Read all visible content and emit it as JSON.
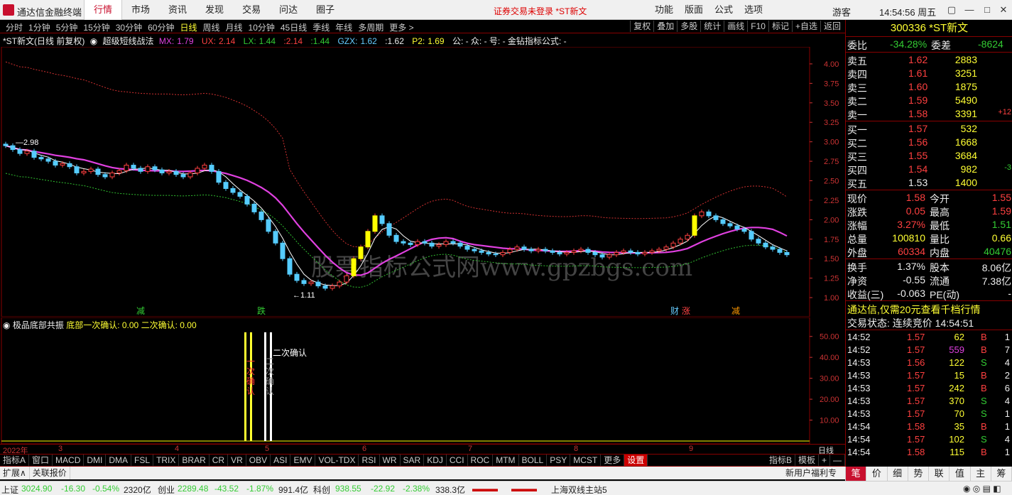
{
  "titlebar": {
    "app_name": "通达信金融终端",
    "menu": [
      "行情",
      "市场",
      "资讯",
      "发现",
      "交易",
      "问达",
      "圈子"
    ],
    "active_menu": 0,
    "notice": "证券交易未登录  *ST新文",
    "right_menu": [
      "功能",
      "版面",
      "公式",
      "选项"
    ],
    "user": "游客",
    "clock": "14:54:56 周五"
  },
  "periodbar": {
    "items": [
      "分时",
      "1分钟",
      "5分钟",
      "15分钟",
      "30分钟",
      "60分钟",
      "日线",
      "周线",
      "月线",
      "10分钟",
      "45日线",
      "季线",
      "年线",
      "多周期",
      "更多 >"
    ],
    "active": 6,
    "tools": [
      "复权",
      "叠加",
      "多股",
      "统计",
      "画线",
      "F10",
      "标记",
      "+自选",
      "返回"
    ]
  },
  "chartinfo": {
    "name": "*ST新文(日线 前复权)",
    "indicator": "超级短线战法",
    "mx_label": "MX:",
    "mx": "1.79",
    "ux_label": "UX:",
    "ux": "2.14",
    "lx_label": "LX:",
    "lx": "1.44",
    "v1": "2.14",
    "v2": "1.44",
    "gzx_label": "GZX:",
    "gzx": "1.62",
    "v3": "1.62",
    "p2_label": "P2:",
    "p2": "1.69",
    "tail": "公: -  众: -  号: -  金钻指标公式: -"
  },
  "chart_data": [
    {
      "type": "candlestick",
      "ylim": [
        0.8,
        4.2
      ],
      "y_ticks": [
        "4.00",
        "3.75",
        "3.50",
        "3.25",
        "3.00",
        "2.75",
        "2.50",
        "2.25",
        "2.00",
        "1.75",
        "1.50",
        "1.25",
        "1.00"
      ],
      "annotations": [
        "2.98",
        "1.11"
      ],
      "markers": [
        "减",
        "跌",
        "财",
        "涨",
        "减"
      ],
      "close": [
        2.95,
        2.9,
        2.85,
        2.88,
        2.8,
        2.78,
        2.75,
        2.7,
        2.72,
        2.68,
        2.6,
        2.62,
        2.65,
        2.58,
        2.55,
        2.6,
        2.63,
        2.7,
        2.66,
        2.62,
        2.68,
        2.64,
        2.6,
        2.62,
        2.58,
        2.55,
        2.6,
        2.66,
        2.7,
        2.62,
        2.48,
        2.4,
        2.35,
        2.3,
        2.2,
        2.1,
        2.0,
        1.85,
        1.7,
        1.5,
        1.3,
        1.22,
        1.18,
        1.2,
        1.15,
        1.12,
        1.15,
        1.2,
        1.28,
        1.5,
        1.65,
        1.85,
        2.05,
        1.95,
        1.8,
        1.72,
        1.7,
        1.68,
        1.72,
        1.7,
        1.66,
        1.68,
        1.72,
        1.7,
        1.66,
        1.62,
        1.6,
        1.58,
        1.56,
        1.55,
        1.58,
        1.62,
        1.65,
        1.62,
        1.6,
        1.62,
        1.6,
        1.58,
        1.56,
        1.58,
        1.6,
        1.62,
        1.58,
        1.55,
        1.52,
        1.55,
        1.58,
        1.6,
        1.58,
        1.56,
        1.58,
        1.6,
        1.62,
        1.65,
        1.7,
        1.75,
        1.8,
        2.05,
        2.1,
        2.05,
        2.0,
        1.95,
        1.92,
        1.88,
        1.85,
        1.75,
        1.7,
        1.65,
        1.62,
        1.58,
        1.55
      ],
      "series": [
        {
          "name": "MX",
          "color": "#e040e0"
        },
        {
          "name": "UX",
          "color": "#d03030"
        },
        {
          "name": "LX",
          "color": "#30c030"
        },
        {
          "name": "GZX",
          "color": "#ffffff"
        }
      ]
    },
    {
      "type": "bar",
      "ylim": [
        0,
        55
      ],
      "y_ticks": [
        "50.00",
        "40.00",
        "30.00",
        "20.00",
        "10.00"
      ],
      "bars": [
        {
          "label": "一次确认",
          "value": 52,
          "color": "#ffff30"
        },
        {
          "label": "二次确认",
          "value": 52,
          "color": "#ffffff"
        }
      ]
    }
  ],
  "subinfo": {
    "name": "极品底部共振",
    "label1": "底部一次确认:",
    "val1": "0.00",
    "label2": "二次确认:",
    "val2": "0.00",
    "annot": "二次确认"
  },
  "datebar": [
    "2022年",
    "3",
    "4",
    "5",
    "6",
    "7",
    "8",
    "9"
  ],
  "datebar_right": "日线",
  "indbar": [
    "指标A",
    "窗口",
    "MACD",
    "DMI",
    "DMA",
    "FSL",
    "TRIX",
    "BRAR",
    "CR",
    "VR",
    "OBV",
    "ASI",
    "EMV",
    "VOL-TDX",
    "RSI",
    "WR",
    "SAR",
    "KDJ",
    "CCI",
    "ROC",
    "MTM",
    "BOLL",
    "PSY",
    "MCST",
    "更多",
    "设置"
  ],
  "indbar_active": 25,
  "indbar_right": [
    "指标B",
    "模板",
    "+",
    "—"
  ],
  "expandbar": [
    "扩展∧",
    "关联报价"
  ],
  "expand_right": "新用户福利专享",
  "statusbar": {
    "sh_name": "上证",
    "sh": "3024.90",
    "sh_chg": "-16.30",
    "sh_pct": "-0.54%",
    "sh_amt": "2320亿",
    "cy_name": "创业",
    "cy": "2289.48",
    "cy_chg": "-43.52",
    "cy_pct": "-1.87%",
    "cy_amt": "991.4亿",
    "kc_name": "科创",
    "kc": "938.55",
    "kc_chg": "-22.92",
    "kc_pct": "-2.38%",
    "kc_amt": "338.3亿",
    "server": "上海双线主站5"
  },
  "rpanel": {
    "code": "300336",
    "name": "*ST新文",
    "wb_label": "委比",
    "wb": "-34.28%",
    "wc_label": "委差",
    "wc": "-8624",
    "asks": [
      {
        "label": "卖五",
        "price": "1.62",
        "vol": "2883",
        "chg": ""
      },
      {
        "label": "卖四",
        "price": "1.61",
        "vol": "3251",
        "chg": ""
      },
      {
        "label": "卖三",
        "price": "1.60",
        "vol": "1875",
        "chg": ""
      },
      {
        "label": "卖二",
        "price": "1.59",
        "vol": "5490",
        "chg": ""
      },
      {
        "label": "卖一",
        "price": "1.58",
        "vol": "3391",
        "chg": "+12"
      }
    ],
    "bids": [
      {
        "label": "买一",
        "price": "1.57",
        "vol": "532",
        "chg": ""
      },
      {
        "label": "买二",
        "price": "1.56",
        "vol": "1668",
        "chg": ""
      },
      {
        "label": "买三",
        "price": "1.55",
        "vol": "3684",
        "chg": ""
      },
      {
        "label": "买四",
        "price": "1.54",
        "vol": "982",
        "chg": "-3"
      },
      {
        "label": "买五",
        "price": "1.53",
        "vol": "1400",
        "chg": ""
      }
    ],
    "quote": [
      {
        "l1": "现价",
        "v1": "1.58",
        "c1": "red",
        "l2": "今开",
        "v2": "1.55",
        "c2": "red"
      },
      {
        "l1": "涨跌",
        "v1": "0.05",
        "c1": "red",
        "l2": "最高",
        "v2": "1.59",
        "c2": "red"
      },
      {
        "l1": "涨幅",
        "v1": "3.27%",
        "c1": "red",
        "l2": "最低",
        "v2": "1.51",
        "c2": "green"
      },
      {
        "l1": "总量",
        "v1": "100810",
        "c1": "yellow",
        "l2": "量比",
        "v2": "0.66",
        "c2": "yellow"
      },
      {
        "l1": "外盘",
        "v1": "60334",
        "c1": "red",
        "l2": "内盘",
        "v2": "40476",
        "c2": "green"
      }
    ],
    "finance": [
      {
        "l1": "换手",
        "v1": "1.37%",
        "l2": "股本",
        "v2": "8.06亿"
      },
      {
        "l1": "净资",
        "v1": "-0.55",
        "l2": "流通",
        "v2": "7.38亿"
      },
      {
        "l1": "收益(三)",
        "v1": "-0.063",
        "l2": "PE(动)",
        "v2": "-"
      }
    ],
    "ad": "通达信,仅需20元查看千档行情",
    "trade_state": "交易状态: 连续竞价  14:54:51",
    "ticks": [
      {
        "t": "14:52",
        "p": "1.57",
        "v": "62",
        "bs": "B",
        "n": "1",
        "vc": "yellow"
      },
      {
        "t": "14:52",
        "p": "1.57",
        "v": "559",
        "bs": "B",
        "n": "7",
        "vc": "magenta"
      },
      {
        "t": "14:53",
        "p": "1.56",
        "v": "122",
        "bs": "S",
        "n": "4",
        "vc": "yellow"
      },
      {
        "t": "14:53",
        "p": "1.57",
        "v": "15",
        "bs": "B",
        "n": "2",
        "vc": "yellow"
      },
      {
        "t": "14:53",
        "p": "1.57",
        "v": "242",
        "bs": "B",
        "n": "6",
        "vc": "yellow"
      },
      {
        "t": "14:53",
        "p": "1.57",
        "v": "370",
        "bs": "S",
        "n": "4",
        "vc": "yellow"
      },
      {
        "t": "14:53",
        "p": "1.57",
        "v": "70",
        "bs": "S",
        "n": "1",
        "vc": "yellow"
      },
      {
        "t": "14:54",
        "p": "1.58",
        "v": "35",
        "bs": "B",
        "n": "1",
        "vc": "yellow"
      },
      {
        "t": "14:54",
        "p": "1.57",
        "v": "102",
        "bs": "S",
        "n": "4",
        "vc": "yellow"
      },
      {
        "t": "14:54",
        "p": "1.58",
        "v": "115",
        "bs": "B",
        "n": "1",
        "vc": "yellow"
      }
    ]
  },
  "rtabs": [
    "笔",
    "价",
    "细",
    "势",
    "联",
    "值",
    "主",
    "筹"
  ],
  "rtabs_active": 0,
  "watermark": "股票指标公式网www.gpzbgs.com"
}
